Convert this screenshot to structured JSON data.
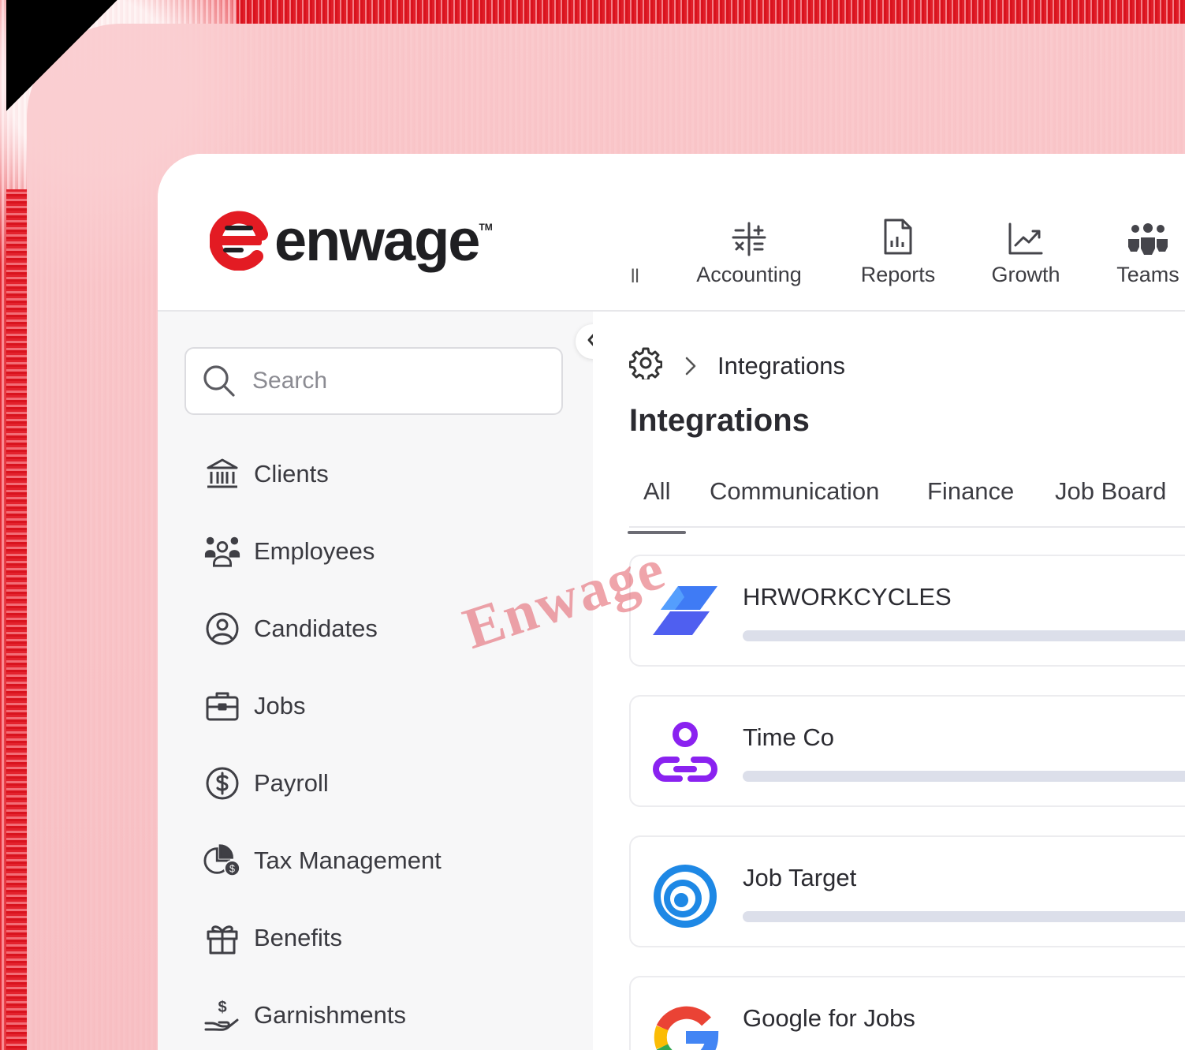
{
  "brand": {
    "name": "enwage",
    "trademark": "TM",
    "red": "#e31b23",
    "dark": "#1f1f22"
  },
  "topnav": {
    "truncated": "ll",
    "items": [
      {
        "label": "Accounting",
        "icon": "calculator-icon"
      },
      {
        "label": "Reports",
        "icon": "report-file-icon"
      },
      {
        "label": "Growth",
        "icon": "growth-chart-icon"
      },
      {
        "label": "Teams",
        "icon": "team-icon"
      }
    ]
  },
  "sidebar": {
    "search_placeholder": "Search",
    "items": [
      {
        "label": "Clients",
        "icon": "bank-icon"
      },
      {
        "label": "Employees",
        "icon": "employees-icon"
      },
      {
        "label": "Candidates",
        "icon": "user-circle-icon"
      },
      {
        "label": "Jobs",
        "icon": "briefcase-icon"
      },
      {
        "label": "Payroll",
        "icon": "dollar-circle-icon"
      },
      {
        "label": "Tax Management",
        "icon": "tax-pie-icon"
      },
      {
        "label": "Benefits",
        "icon": "gift-icon"
      },
      {
        "label": "Garnishments",
        "icon": "hand-money-icon"
      }
    ]
  },
  "main": {
    "breadcrumb_current": "Integrations",
    "title": "Integrations",
    "tabs": [
      {
        "label": "All",
        "active": true
      },
      {
        "label": "Communication",
        "active": false
      },
      {
        "label": "Finance",
        "active": false
      },
      {
        "label": "Job Board",
        "active": false
      }
    ],
    "integrations": [
      {
        "name": "HRWORKCYCLES",
        "logo": "hrworkcycles-logo"
      },
      {
        "name": "Time Co",
        "logo": "timeco-logo"
      },
      {
        "name": "Job Target",
        "logo": "jobtarget-logo"
      },
      {
        "name": "Google for Jobs",
        "logo": "google-logo"
      }
    ]
  },
  "watermark": "Enwage"
}
